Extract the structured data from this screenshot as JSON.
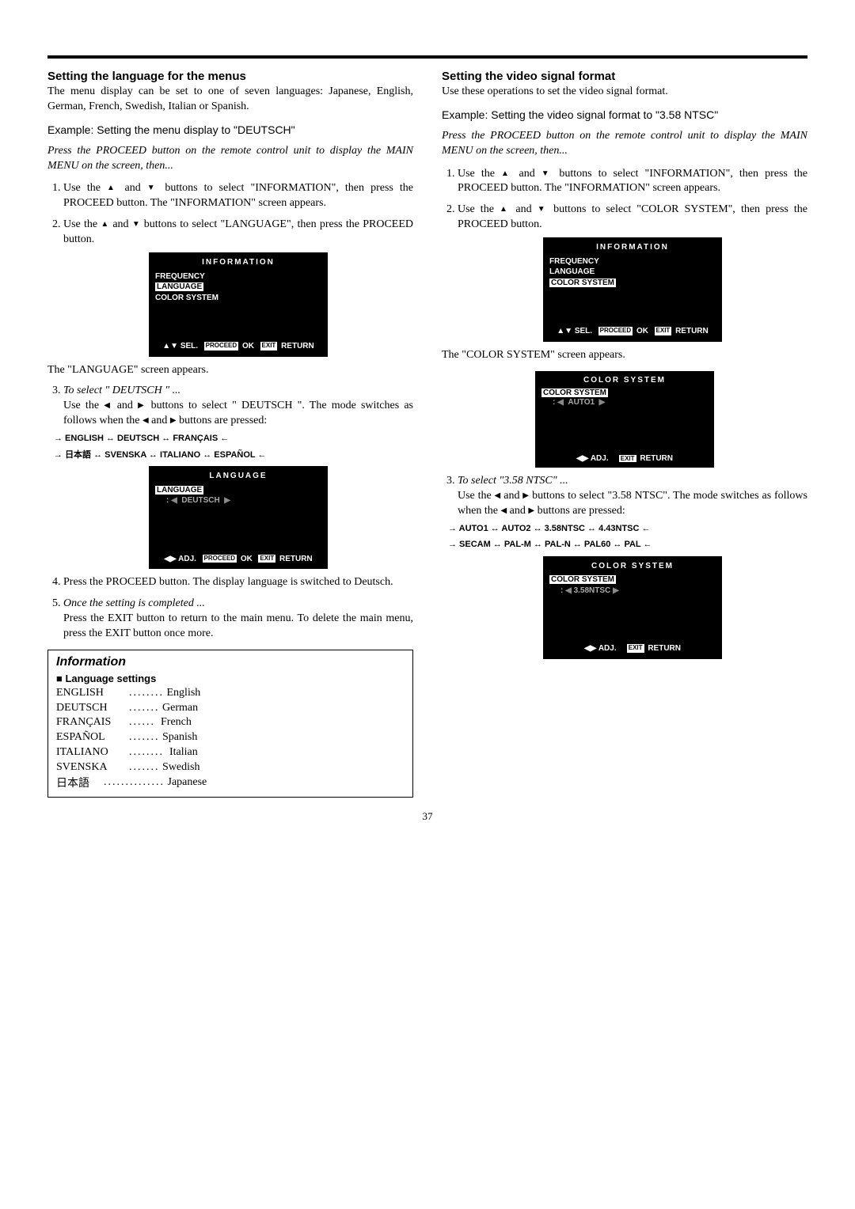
{
  "page_number": "37",
  "left": {
    "heading": "Setting the language for the menus",
    "intro": "The menu display can be set to one of seven languages: Japanese, English, German, French, Swedish, Italian or Spanish.",
    "example": "Example: Setting the menu display to \"DEUTSCH\"",
    "instruction": "Press the PROCEED button on the remote control unit to display the MAIN MENU on the screen, then...",
    "step1a": "Use the ",
    "step1b": " and ",
    "step1c": " buttons to select \"INFORMATION\", then press the PROCEED button. The \"INFORMATION\" screen appears.",
    "step2a": "Use the ",
    "step2b": " and ",
    "step2c": " buttons to select \"LANGUAGE\", then press the PROCEED button.",
    "osd1": {
      "title": "INFORMATION",
      "i1": "FREQUENCY",
      "i2": "LANGUAGE",
      "i3": "COLOR SYSTEM"
    },
    "after_osd1": "The \"LANGUAGE\" screen appears.",
    "step3_lead": "To select \" DEUTSCH \" ...",
    "step3a": "Use the ",
    "step3b": " and ",
    "step3c": " buttons to select \" DEUTSCH \". The mode switches as follows when the ",
    "step3d": " and ",
    "step3e": " buttons are pressed:",
    "cycle1": "→ ENGLISH ↔ DEUTSCH ↔ FRANÇAIS ←",
    "cycle2_pre": "→ ",
    "cycle2_jp": "日本語",
    "cycle2_post": " ↔ SVENSKA ↔ ITALIANO ↔ ESPAÑOL ←",
    "osd2": {
      "title": "LANGUAGE",
      "i1": "LANGUAGE",
      "val": "DEUTSCH"
    },
    "step4": "Press the PROCEED button. The display language is switched to Deutsch.",
    "step5_lead": "Once the setting is completed ...",
    "step5_body": "Press the EXIT button to return to the main menu. To delete the main menu, press the EXIT button once more.",
    "info_title": "Information",
    "info_sub": "Language settings",
    "langs": [
      {
        "code": "ENGLISH",
        "dots": "........",
        "name": "English"
      },
      {
        "code": "DEUTSCH",
        "dots": ".......",
        "name": "German"
      },
      {
        "code": "FRANÇAIS",
        "dots": "......",
        "name": "French"
      },
      {
        "code": "ESPAÑOL",
        "dots": ".......",
        "name": "Spanish"
      },
      {
        "code": "ITALIANO",
        "dots": "........",
        "name": "Italian"
      },
      {
        "code": "SVENSKA",
        "dots": ".......",
        "name": "Swedish"
      },
      {
        "code": "日本語",
        "dots": "..............",
        "name": "Japanese"
      }
    ]
  },
  "right": {
    "heading": "Setting the video signal format",
    "intro": "Use these operations to set the video signal format.",
    "example": "Example: Setting the video signal format to \"3.58 NTSC\"",
    "instruction": "Press the PROCEED button on the remote control unit to display the MAIN MENU on the screen, then...",
    "step1a": "Use the ",
    "step1b": " and ",
    "step1c": " buttons to select \"INFORMATION\", then press the PROCEED button. The \"INFORMATION\" screen appears.",
    "step2a": "Use the ",
    "step2b": " and ",
    "step2c": " buttons to select \"COLOR SYSTEM\", then press the PROCEED button.",
    "osd1": {
      "title": "INFORMATION",
      "i1": "FREQUENCY",
      "i2": "LANGUAGE",
      "i3": "COLOR SYSTEM"
    },
    "after_osd1": "The \"COLOR SYSTEM\" screen appears.",
    "osd2": {
      "title": "COLOR SYSTEM",
      "i1": "COLOR SYSTEM",
      "val": "AUTO1"
    },
    "step3_lead": "To select \"3.58 NTSC\" ...",
    "step3a": "Use the ",
    "step3b": " and ",
    "step3c": " buttons to select \"3.58 NTSC\". The mode switches as follows when the ",
    "step3d": " and ",
    "step3e": " buttons are pressed:",
    "cycle1": "→ AUTO1 ↔ AUTO2 ↔ 3.58NTSC ↔ 4.43NTSC ←",
    "cycle2": "→ SECAM ↔ PAL-M ↔ PAL-N ↔ PAL60 ↔ PAL ←",
    "osd3": {
      "title": "COLOR SYSTEM",
      "i1": "COLOR SYSTEM",
      "val": "3.58NTSC"
    }
  },
  "osd_foot": {
    "sel": "SEL.",
    "adj": "ADJ.",
    "proceed": "PROCEED",
    "ok": "OK",
    "exit": "EXIT",
    "return": "RETURN"
  }
}
